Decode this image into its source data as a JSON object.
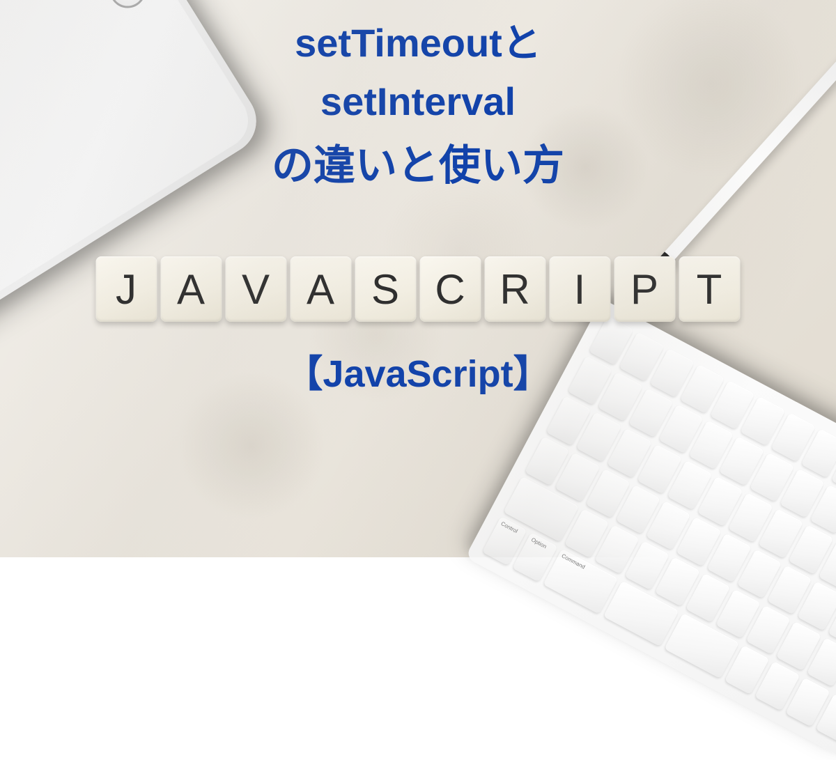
{
  "title": {
    "line1": "setTimeoutと",
    "line2": "setInterval",
    "line3": "の違いと使い方",
    "line4": "【JavaScript】"
  },
  "tiles": [
    "J",
    "A",
    "V",
    "A",
    "S",
    "C",
    "R",
    "I",
    "P",
    "T"
  ],
  "keyboard": {
    "visible_keys": [
      "Control",
      "Option",
      "Command"
    ]
  },
  "colors": {
    "text": "#1142aa",
    "tile_bg": "#f2eee2",
    "marble": "#ede9e2"
  }
}
